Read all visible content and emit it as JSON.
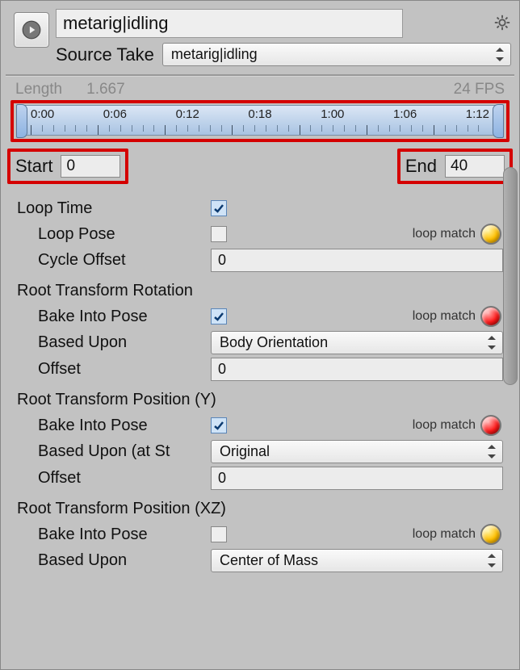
{
  "header": {
    "clip_name": "metarig|idling",
    "source_take_label": "Source Take",
    "source_take_value": "metarig|idling"
  },
  "length": {
    "label": "Length",
    "value": "1.667",
    "fps": "24 FPS"
  },
  "timeline": {
    "marks": [
      "0:00",
      "0:06",
      "0:12",
      "0:18",
      "1:00",
      "1:06",
      "1:12"
    ]
  },
  "range": {
    "start_label": "Start",
    "start_value": "0",
    "end_label": "End",
    "end_value": "40"
  },
  "loop": {
    "time_label": "Loop Time",
    "pose_label": "Loop Pose",
    "cycle_label": "Cycle Offset",
    "cycle_value": "0",
    "match_label": "loop match"
  },
  "rot": {
    "title": "Root Transform Rotation",
    "bake_label": "Bake Into Pose",
    "based_label": "Based Upon",
    "based_value": "Body Orientation",
    "offset_label": "Offset",
    "offset_value": "0",
    "match_label": "loop match"
  },
  "posY": {
    "title": "Root Transform Position (Y)",
    "bake_label": "Bake Into Pose",
    "based_label": "Based Upon (at St",
    "based_value": "Original",
    "offset_label": "Offset",
    "offset_value": "0",
    "match_label": "loop match"
  },
  "posXZ": {
    "title": "Root Transform Position (XZ)",
    "bake_label": "Bake Into Pose",
    "based_label": "Based Upon",
    "based_value": "Center of Mass",
    "match_label": "loop match"
  }
}
